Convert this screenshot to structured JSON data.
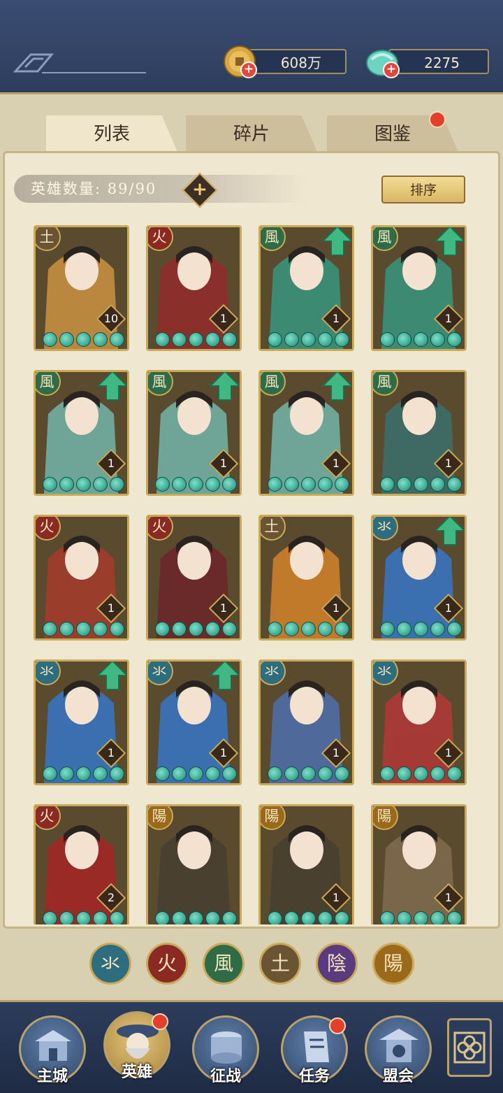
{
  "resources": {
    "coins": "608万",
    "jade": "2275"
  },
  "tabs": [
    {
      "label": "列表",
      "active": true,
      "badge": false
    },
    {
      "label": "碎片",
      "active": false,
      "badge": false
    },
    {
      "label": "图鉴",
      "active": false,
      "badge": true
    }
  ],
  "hero_count": {
    "label": "英雄数量:",
    "value": "89/90"
  },
  "sort_label": "排序",
  "elements": {
    "water": {
      "glyph": "氺",
      "color": "#2e6d7d"
    },
    "fire": {
      "glyph": "火",
      "color": "#8a2a22"
    },
    "wind": {
      "glyph": "風",
      "color": "#2f6b45"
    },
    "earth": {
      "glyph": "土",
      "color": "#6a5434"
    },
    "yin": {
      "glyph": "陰",
      "color": "#5b3a7d"
    },
    "yang": {
      "glyph": "陽",
      "color": "#9a6a1a"
    }
  },
  "heroes": [
    {
      "element": "土",
      "level": "10",
      "upgrade": false,
      "art": "#b9873d"
    },
    {
      "element": "火",
      "level": "1",
      "upgrade": false,
      "art": "#8a2f2b"
    },
    {
      "element": "風",
      "level": "1",
      "upgrade": true,
      "art": "#3d8a72"
    },
    {
      "element": "風",
      "level": "1",
      "upgrade": true,
      "art": "#3d8a72"
    },
    {
      "element": "風",
      "level": "1",
      "upgrade": true,
      "art": "#6fa597"
    },
    {
      "element": "風",
      "level": "1",
      "upgrade": true,
      "art": "#6fa597"
    },
    {
      "element": "風",
      "level": "1",
      "upgrade": true,
      "art": "#6fa597"
    },
    {
      "element": "風",
      "level": "1",
      "upgrade": false,
      "art": "#3f6a63"
    },
    {
      "element": "火",
      "level": "1",
      "upgrade": false,
      "art": "#9a3d2b"
    },
    {
      "element": "火",
      "level": "1",
      "upgrade": false,
      "art": "#6b2a2a"
    },
    {
      "element": "土",
      "level": "1",
      "upgrade": false,
      "art": "#c07a2a"
    },
    {
      "element": "氺",
      "level": "1",
      "upgrade": true,
      "art": "#3b6fb0"
    },
    {
      "element": "氺",
      "level": "1",
      "upgrade": true,
      "art": "#3b6fb0"
    },
    {
      "element": "氺",
      "level": "1",
      "upgrade": true,
      "art": "#3b6fb0"
    },
    {
      "element": "氺",
      "level": "1",
      "upgrade": false,
      "art": "#4f6a9a"
    },
    {
      "element": "氺",
      "level": "1",
      "upgrade": false,
      "art": "#a53a36"
    },
    {
      "element": "火",
      "level": "2",
      "upgrade": false,
      "art": "#9a2a25"
    },
    {
      "element": "陽",
      "level": "",
      "upgrade": false,
      "art": "#4a4030"
    },
    {
      "element": "陽",
      "level": "1",
      "upgrade": false,
      "art": "#4a4030"
    },
    {
      "element": "陽",
      "level": "1",
      "upgrade": false,
      "art": "#7a6648"
    }
  ],
  "filter_elements": [
    "氺",
    "火",
    "風",
    "土",
    "陰",
    "陽"
  ],
  "nav": [
    {
      "label": "主城",
      "badge": false,
      "active": false
    },
    {
      "label": "英雄",
      "badge": true,
      "active": true
    },
    {
      "label": "征战",
      "badge": false,
      "active": false
    },
    {
      "label": "任务",
      "badge": true,
      "active": false
    },
    {
      "label": "盟会",
      "badge": false,
      "active": false
    }
  ]
}
